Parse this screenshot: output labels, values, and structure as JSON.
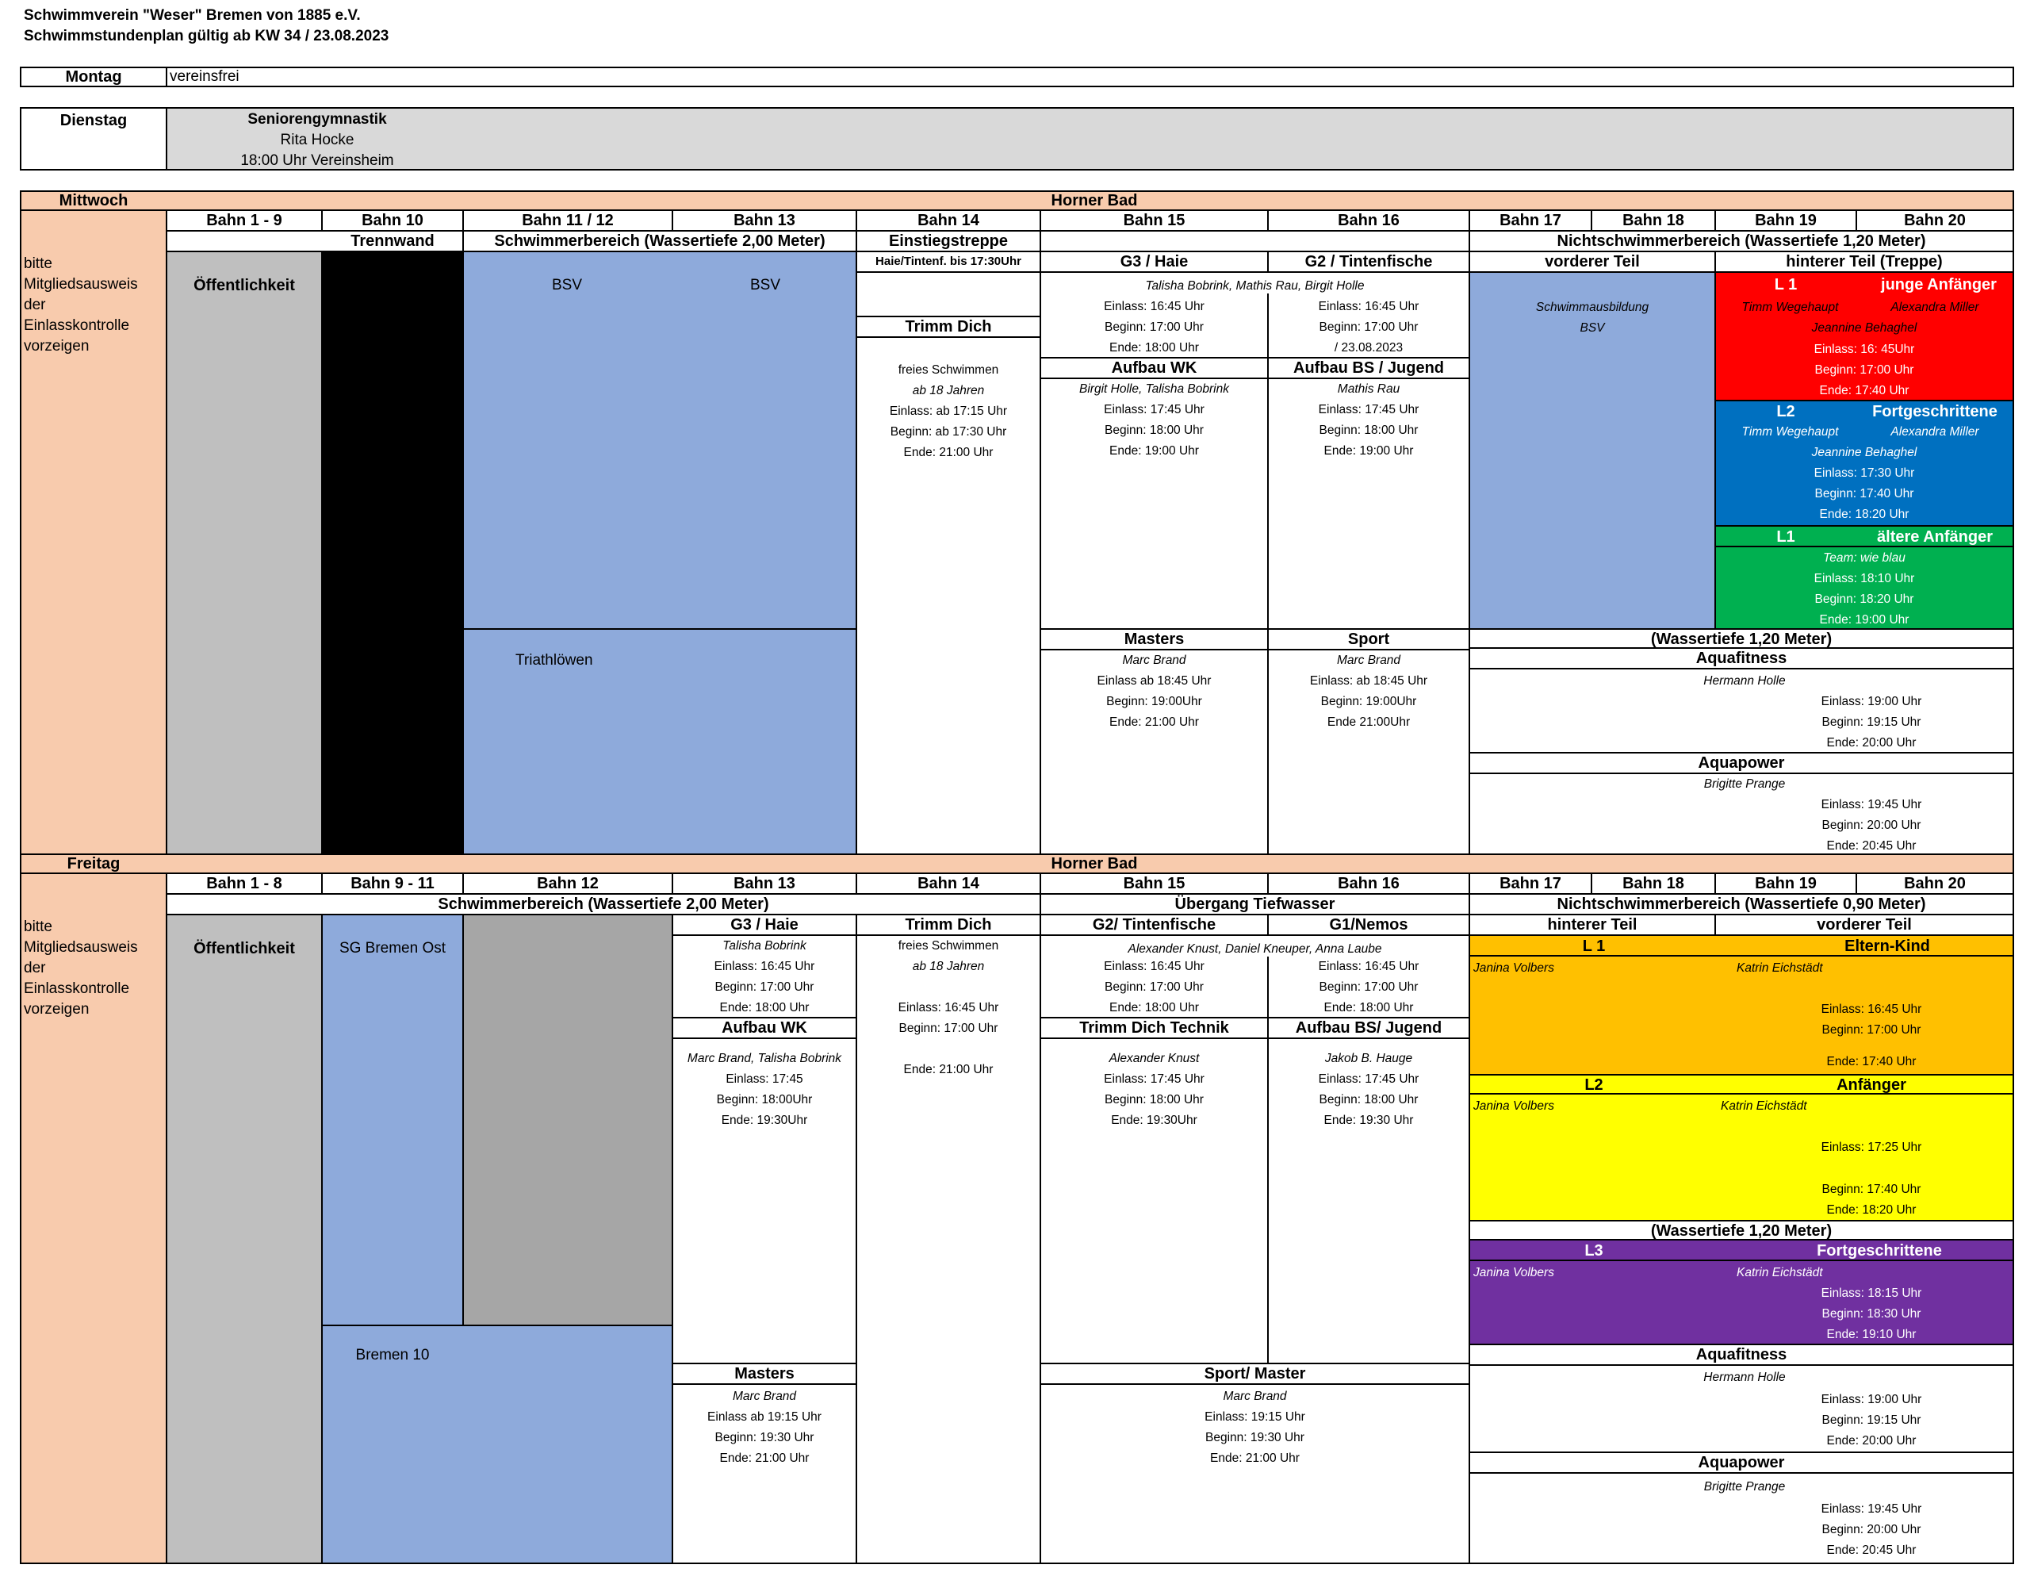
{
  "header": {
    "line1": "Schwimmverein \"Weser\" Bremen von 1885 e.V.",
    "line2": "Schwimmstundenplan gültig ab KW 34 / 23.08.2023"
  },
  "montag": {
    "day": "Montag",
    "text": "vereinsfrei"
  },
  "dienstag": {
    "day": "Dienstag",
    "course": "Seniorengymnastik",
    "leader": "Rita Hocke",
    "time": "18:00 Uhr  Vereinsheim"
  },
  "mittwoch": {
    "day": "Mittwoch",
    "venue": "Horner Bad",
    "lanes": [
      "Bahn 1 - 9",
      "Bahn 10",
      "Bahn 11 / 12",
      "Bahn 13",
      "Bahn 14",
      "Bahn 15",
      "Bahn 16",
      "Bahn 17",
      "Bahn 18",
      "Bahn 19",
      "Bahn 20"
    ],
    "note": [
      "bitte",
      "Mitgliedsausweis",
      "der",
      "Einlasskontrolle",
      "vorzeigen"
    ],
    "trennwand": "Trennwand",
    "schwimmer": "Schwimmerbereich (Wassertiefe 2,00 Meter)",
    "einstieg": "Einstiegstreppe",
    "haie_note": "Haie/Tintenf. bis 17:30Uhr",
    "nichtschwimmer": "Nichtschwimmerbereich (Wassertiefe 1,20 Meter)",
    "g3": "G3 / Haie",
    "g2": "G2 / Tintenfische",
    "vorderer": "vorderer Teil",
    "hinterer": "hinterer Teil (Treppe)",
    "oeff": "Öffentlichkeit",
    "bsv1": "BSV",
    "bsv2": "BSV",
    "trimm": "Trimm Dich",
    "trimm_lines": [
      "freies Schwimmen",
      "ab 18 Jahren",
      "Einlass: ab 17:15 Uhr",
      "Beginn: ab 17:30 Uhr",
      "Ende: 21:00 Uhr"
    ],
    "g_trainers": "Talisha Bobrink, Mathis Rau, Birgit Holle",
    "g3_times": [
      "Einlass: 16:45 Uhr",
      "Beginn: 17:00 Uhr",
      "Ende: 18:00 Uhr"
    ],
    "g2_times": [
      "Einlass: 16:45 Uhr",
      "Beginn: 17:00 Uhr",
      "/ 23.08.2023"
    ],
    "aufbau_wk": "Aufbau WK",
    "aufbau_bs": "Aufbau BS / Jugend",
    "aufbau_wk_trainer": "Birgit Holle, Talisha Bobrink",
    "aufbau_wk_times": [
      "Einlass: 17:45 Uhr",
      "Beginn: 18:00 Uhr",
      "Ende: 19:00 Uhr"
    ],
    "aufbau_bs_trainer": "Mathis Rau",
    "aufbau_bs_times": [
      "Einlass: 17:45 Uhr",
      "Beginn: 18:00 Uhr",
      "Ende: 19:00  Uhr"
    ],
    "schwimmausbildung": "Schwimmausbildung",
    "sa_bsv": "BSV",
    "l1a_code": "L 1",
    "l1a_name": "junge Anfänger",
    "l1a_t1": "Timm Wegehaupt",
    "l1a_t2": "Alexandra Miller",
    "l1a_t3": "Jeannine Behaghel",
    "l1a_times": [
      "Einlass: 16: 45Uhr",
      "Beginn: 17:00 Uhr",
      "Ende: 17:40 Uhr"
    ],
    "l2_code": "L2",
    "l2_name": "Fortgeschrittene",
    "l2_t1": "Timm Wegehaupt",
    "l2_t2": "Alexandra Miller",
    "l2_t3": "Jeannine Behaghel",
    "l2_times": [
      "Einlass: 17:30 Uhr",
      "Beginn: 17:40 Uhr",
      "Ende: 18:20 Uhr"
    ],
    "l1b_code": "L1",
    "l1b_name": "ältere Anfänger",
    "l1b_team": "Team: wie blau",
    "l1b_times": [
      "Einlass: 18:10 Uhr",
      "Beginn: 18:20 Uhr",
      "Ende: 19:00 Uhr"
    ],
    "triath": "Triathlöwen",
    "masters": "Masters",
    "sport": "Sport",
    "masters_trainer": "Marc Brand",
    "masters_times": [
      "Einlass ab  18:45 Uhr",
      "Beginn: 19:00Uhr",
      "Ende: 21:00 Uhr"
    ],
    "sport_trainer": "Marc Brand",
    "sport_times": [
      "Einlass: ab 18:45 Uhr",
      "Beginn: 19:00Uhr",
      "Ende 21:00Uhr"
    ],
    "wt120": "(Wassertiefe 1,20 Meter)",
    "aquafit": "Aquafitness",
    "aquafit_trainer": "Hermann Holle",
    "aquafit_times": [
      "Einlass: 19:00 Uhr",
      "Beginn: 19:15 Uhr",
      "Ende: 20:00 Uhr"
    ],
    "aquapow": "Aquapower",
    "aquapow_trainer": "Brigitte Prange",
    "aquapow_times": [
      "Einlass: 19:45 Uhr",
      "Beginn: 20:00 Uhr",
      "Ende: 20:45 Uhr"
    ]
  },
  "freitag": {
    "day": "Freitag",
    "venue": "Horner Bad",
    "lanes": [
      "Bahn 1 - 8",
      "Bahn 9 - 11",
      "Bahn 12",
      "Bahn 13",
      "Bahn 14",
      "Bahn 15",
      "Bahn 16",
      "Bahn 17",
      "Bahn 18",
      "Bahn 19",
      "Bahn 20"
    ],
    "note": [
      "bitte",
      "Mitgliedsausweis",
      "der",
      "Einlasskontrolle",
      "vorzeigen"
    ],
    "schwimmer": "Schwimmerbereich (Wassertiefe 2,00 Meter)",
    "uebergang": "Übergang Tiefwasser",
    "nichtschwimmer": "Nichtschwimmerbereich (Wassertiefe 0,90 Meter)",
    "g3": "G3 / Haie",
    "trimm": "Trimm Dich",
    "g2": "G2/ Tintenfische",
    "g1": "G1/Nemos",
    "hinterer": "hinterer Teil",
    "vorderer": "vorderer Teil",
    "oeff": "Öffentlichkeit",
    "sg": "SG Bremen Ost",
    "g3_trainer": "Talisha Bobrink",
    "g3_times": [
      "Einlass: 16:45 Uhr",
      "Beginn: 17:00 Uhr",
      "Ende: 18:00 Uhr"
    ],
    "trimm_l1": "freies Schwimmen",
    "trimm_l2": "ab 18 Jahren",
    "trimm_times": [
      "Einlass: 16:45 Uhr",
      "Beginn: 17:00 Uhr"
    ],
    "trimm_end": "Ende: 21:00 Uhr",
    "g_trainers": "Alexander Knust, Daniel Kneuper, Anna Laube",
    "g2_times": [
      "Einlass: 16:45 Uhr",
      "Beginn: 17:00 Uhr",
      "Ende: 18:00 Uhr"
    ],
    "g1_times": [
      "Einlass: 16:45 Uhr",
      "Beginn: 17:00 Uhr",
      "Ende: 18:00 Uhr"
    ],
    "l1_code": "L 1",
    "l1_name": "Eltern-Kind",
    "l1_t1": "Janina Volbers",
    "l1_t2": "Katrin Eichstädt",
    "l1_times": [
      "Einlass: 16:45 Uhr",
      "Beginn: 17:00 Uhr"
    ],
    "l1_end": "Ende: 17:40 Uhr",
    "aufbau_wk": "Aufbau WK",
    "aufbau_wk_trainer": "Marc Brand, Talisha Bobrink",
    "aufbau_wk_times": [
      "Einlass: 17:45",
      "Beginn: 18:00Uhr",
      "Ende: 19:30Uhr"
    ],
    "trimm_tech": "Trimm Dich Technik",
    "aufbau_bs": "Aufbau BS/ Jugend",
    "tech_trainer": "Alexander Knust",
    "tech_times": [
      "Einlass: 17:45 Uhr",
      "Beginn: 18:00 Uhr",
      "Ende: 19:30Uhr"
    ],
    "bs_trainer": "Jakob B. Hauge",
    "bs_times": [
      "Einlass: 17:45 Uhr",
      "Beginn: 18:00 Uhr",
      "Ende: 19:30 Uhr"
    ],
    "l2_code": "L2",
    "l2_name": "Anfänger",
    "l2_t1": "Janina Volbers",
    "l2_t2": "Katrin Eichstädt",
    "l2_einlass": "Einlass: 17:25 Uhr",
    "l2_times": [
      "Beginn: 17:40 Uhr",
      "Ende: 18:20 Uhr"
    ],
    "wt120": "(Wassertiefe 1,20 Meter)",
    "l3_code": "L3",
    "l3_name": "Fortgeschrittene",
    "l3_t1": "Janina Volbers",
    "l3_t2": "Katrin Eichstädt",
    "l3_times": [
      "Einlass: 18:15 Uhr",
      "Beginn: 18:30 Uhr",
      "Ende: 19:10 Uhr"
    ],
    "bremen10": "Bremen 10",
    "masters": "Masters",
    "masters_trainer": "Marc Brand",
    "masters_times": [
      "Einlass ab  19:15 Uhr",
      "Beginn: 19:30 Uhr",
      "Ende: 21:00 Uhr"
    ],
    "sportm": "Sport/ Master",
    "sportm_trainer": "Marc Brand",
    "sportm_times": [
      "Einlass: 19:15 Uhr",
      "Beginn: 19:30 Uhr",
      "Ende: 21:00 Uhr"
    ],
    "aquafit": "Aquafitness",
    "aquafit_trainer": "Hermann Holle",
    "aquafit_times": [
      "Einlass: 19:00 Uhr",
      "Beginn: 19:15 Uhr",
      "Ende: 20:00 Uhr"
    ],
    "aquapow": "Aquapower",
    "aquapow_trainer": "Brigitte Prange",
    "aquapow_times": [
      "Einlass: 19:45 Uhr",
      "Beginn: 20:00 Uhr",
      "Ende: 20:45 Uhr"
    ]
  },
  "colors": {
    "peach": "#f8cbad",
    "gray": "#bfbfbf",
    "blue": "#8eaadb",
    "red": "#ff0000",
    "dark_blue": "#0070c0",
    "green": "#00b050",
    "orange": "#ffc000",
    "yellow": "#ffff00",
    "purple": "#7030a0"
  }
}
